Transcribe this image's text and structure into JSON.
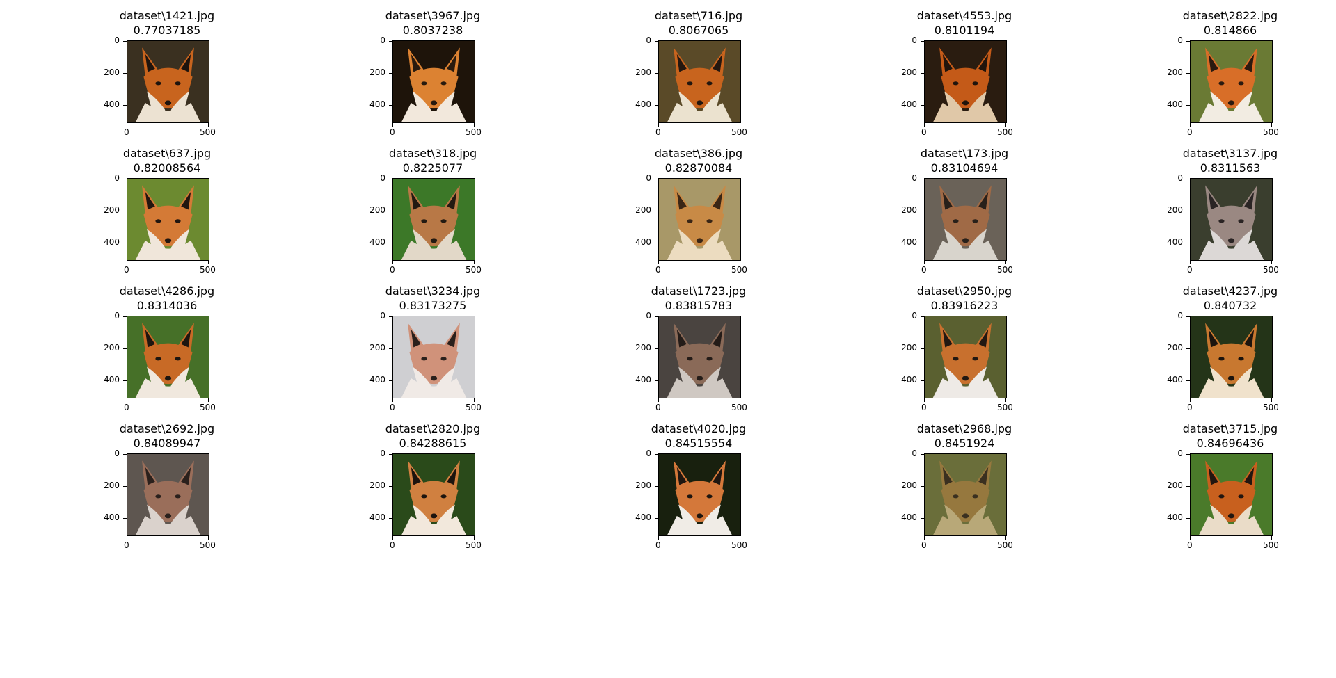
{
  "axis": {
    "y_ticks": [
      "0",
      "200",
      "400"
    ],
    "x_ticks": [
      "0",
      "500"
    ]
  },
  "images": [
    {
      "file": "dataset\\1421.jpg",
      "score": "0.77037185",
      "colors": {
        "bg": "#3a3020",
        "fur": "#c8641e",
        "light": "#ece2d2",
        "dark": "#1e140e"
      }
    },
    {
      "file": "dataset\\3967.jpg",
      "score": "0.8037238",
      "colors": {
        "bg": "#1e140a",
        "fur": "#dc8232",
        "light": "#f2e8dc",
        "dark": "#281a0e"
      }
    },
    {
      "file": "dataset\\716.jpg",
      "score": "0.8067065",
      "colors": {
        "bg": "#5a4a28",
        "fur": "#c8641e",
        "light": "#ebe2cf",
        "dark": "#231710"
      }
    },
    {
      "file": "dataset\\4553.jpg",
      "score": "0.8101194",
      "colors": {
        "bg": "#2a1c10",
        "fur": "#c45a18",
        "light": "#e0c8a8",
        "dark": "#20140c"
      }
    },
    {
      "file": "dataset\\2822.jpg",
      "score": "0.814866",
      "colors": {
        "bg": "#6a7a34",
        "fur": "#d86e28",
        "light": "#f2ece2",
        "dark": "#2a1a10"
      }
    },
    {
      "file": "dataset\\637.jpg",
      "score": "0.82008564",
      "colors": {
        "bg": "#6c8a30",
        "fur": "#d47a36",
        "light": "#f0e6da",
        "dark": "#221610"
      }
    },
    {
      "file": "dataset\\318.jpg",
      "score": "0.8225077",
      "colors": {
        "bg": "#3c7828",
        "fur": "#b87846",
        "light": "#e2d8c8",
        "dark": "#231a12"
      }
    },
    {
      "file": "dataset\\386.jpg",
      "score": "0.82870084",
      "colors": {
        "bg": "#a89868",
        "fur": "#c88a46",
        "light": "#ecdcc0",
        "dark": "#3a2616"
      }
    },
    {
      "file": "dataset\\173.jpg",
      "score": "0.83104694",
      "colors": {
        "bg": "#6a6258",
        "fur": "#a06a46",
        "light": "#d8d4cc",
        "dark": "#28201a"
      }
    },
    {
      "file": "dataset\\3137.jpg",
      "score": "0.8311563",
      "colors": {
        "bg": "#3a3e2e",
        "fur": "#9a8882",
        "light": "#dcd8d6",
        "dark": "#2a2424"
      }
    },
    {
      "file": "dataset\\4286.jpg",
      "score": "0.8314036",
      "colors": {
        "bg": "#467028",
        "fur": "#c86a26",
        "light": "#f0e8de",
        "dark": "#1e1610"
      }
    },
    {
      "file": "dataset\\3234.jpg",
      "score": "0.83173275",
      "colors": {
        "bg": "#cfcfd2",
        "fur": "#d0927a",
        "light": "#f0eae6",
        "dark": "#2a201c"
      }
    },
    {
      "file": "dataset\\1723.jpg",
      "score": "0.83815783",
      "colors": {
        "bg": "#4a4440",
        "fur": "#8a6a58",
        "light": "#cfc8c2",
        "dark": "#241c18"
      }
    },
    {
      "file": "dataset\\2950.jpg",
      "score": "0.83916223",
      "colors": {
        "bg": "#5a6030",
        "fur": "#c8702e",
        "light": "#eeeae6",
        "dark": "#221812"
      }
    },
    {
      "file": "dataset\\4237.jpg",
      "score": "0.840732",
      "colors": {
        "bg": "#243418",
        "fur": "#c87830",
        "light": "#f0e2cc",
        "dark": "#1c140e"
      }
    },
    {
      "file": "dataset\\2692.jpg",
      "score": "0.84089947",
      "colors": {
        "bg": "#5e5650",
        "fur": "#9a6e5a",
        "light": "#dad2cc",
        "dark": "#2a201c"
      }
    },
    {
      "file": "dataset\\2820.jpg",
      "score": "0.84288615",
      "colors": {
        "bg": "#2a4a1a",
        "fur": "#d08040",
        "light": "#f2e8dc",
        "dark": "#1c140e"
      }
    },
    {
      "file": "dataset\\4020.jpg",
      "score": "0.84515554",
      "colors": {
        "bg": "#18200e",
        "fur": "#d4783a",
        "light": "#f0ece6",
        "dark": "#1e1610"
      }
    },
    {
      "file": "dataset\\2968.jpg",
      "score": "0.8451924",
      "colors": {
        "bg": "#6a6e3a",
        "fur": "#96783e",
        "light": "#b8a878",
        "dark": "#3a3020"
      }
    },
    {
      "file": "dataset\\3715.jpg",
      "score": "0.84696436",
      "colors": {
        "bg": "#4a7a2a",
        "fur": "#c8601e",
        "light": "#eadcc8",
        "dark": "#221610"
      }
    }
  ]
}
